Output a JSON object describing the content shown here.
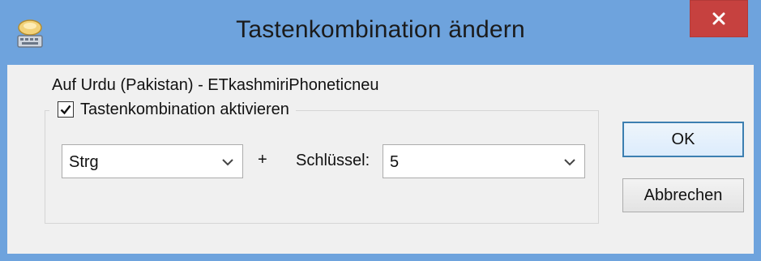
{
  "window": {
    "title": "Tastenkombination ändern",
    "icon": "keyboard-icon",
    "close_label": "×"
  },
  "dialog": {
    "language_label": "Auf Urdu (Pakistan) - ETkashmiriPhoneticneu",
    "enable_checkbox": {
      "label": "Tastenkombination aktivieren",
      "checked": true
    },
    "modifier_select": {
      "value": "Strg"
    },
    "plus_label": "+",
    "key_label": "Schlüssel:",
    "key_select": {
      "value": "5"
    },
    "ok_label": "OK",
    "cancel_label": "Abbrechen"
  },
  "colors": {
    "titlebar": "#6ea3dd",
    "close_button": "#c6413f",
    "dialog_background": "#f0f0f0",
    "default_button_border": "#3c7fb1"
  }
}
